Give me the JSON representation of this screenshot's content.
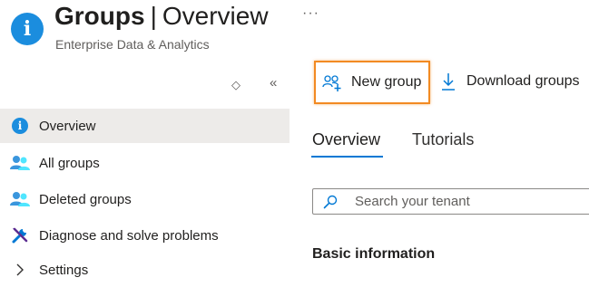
{
  "header": {
    "title_main": "Groups",
    "title_separator": "|",
    "title_sub": "Overview",
    "subtitle": "Enterprise Data & Analytics",
    "more_label": "···",
    "icon": "info-icon"
  },
  "sidebar": {
    "collapse_glyph": "◇",
    "hide_glyph": "«",
    "items": [
      {
        "label": "Overview",
        "icon": "info-icon",
        "active": true
      },
      {
        "label": "All groups",
        "icon": "users-icon"
      },
      {
        "label": "Deleted groups",
        "icon": "users-icon"
      },
      {
        "label": "Diagnose and solve problems",
        "icon": "wrench-icon"
      },
      {
        "label": "Settings",
        "icon": "chevron-right-icon"
      }
    ]
  },
  "toolbar": {
    "new_group_label": "New group",
    "download_groups_label": "Download groups"
  },
  "tabs": [
    {
      "label": "Overview",
      "active": true
    },
    {
      "label": "Tutorials",
      "active": false
    }
  ],
  "search": {
    "placeholder": "Search your tenant",
    "value": ""
  },
  "main": {
    "section_title": "Basic information"
  },
  "colors": {
    "accent": "#0078d4",
    "info_blue": "#1b8dde",
    "highlight_orange": "#f28a22",
    "nav_active_bg": "#edebe9"
  }
}
